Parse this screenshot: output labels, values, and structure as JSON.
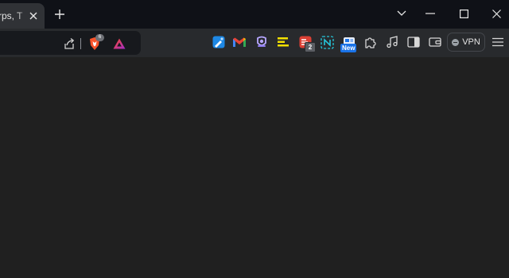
{
  "tab": {
    "title": "rps, T",
    "close_icon": "close-icon"
  },
  "window": {
    "new_tab_icon": "plus-icon",
    "controls": [
      "chevron-down-icon",
      "minimize-icon",
      "maximize-icon",
      "close-icon"
    ]
  },
  "omnibox": {
    "share_icon": "share-icon",
    "shields_count": "6"
  },
  "extensions": [
    {
      "icon": "image-editor-icon"
    },
    {
      "icon": "gmail-icon"
    },
    {
      "icon": "proton-pass-icon"
    },
    {
      "icon": "notes-lines-icon"
    },
    {
      "icon": "todoist-icon",
      "badge": "2"
    },
    {
      "icon": "n-extension-icon"
    },
    {
      "icon": "news-icon",
      "badge": "New"
    },
    {
      "icon": "puzzle-icon"
    },
    {
      "icon": "music-note-icon"
    },
    {
      "icon": "sidebar-icon"
    },
    {
      "icon": "wallet-icon"
    }
  ],
  "vpn": {
    "label": "VPN"
  },
  "colors": {
    "tabstrip_bg": "#0f1117",
    "toolbar_bg": "#282a2d",
    "page_bg": "#202020",
    "accent_blue": "#1a73e8",
    "brave_orange": "#fb542b"
  }
}
